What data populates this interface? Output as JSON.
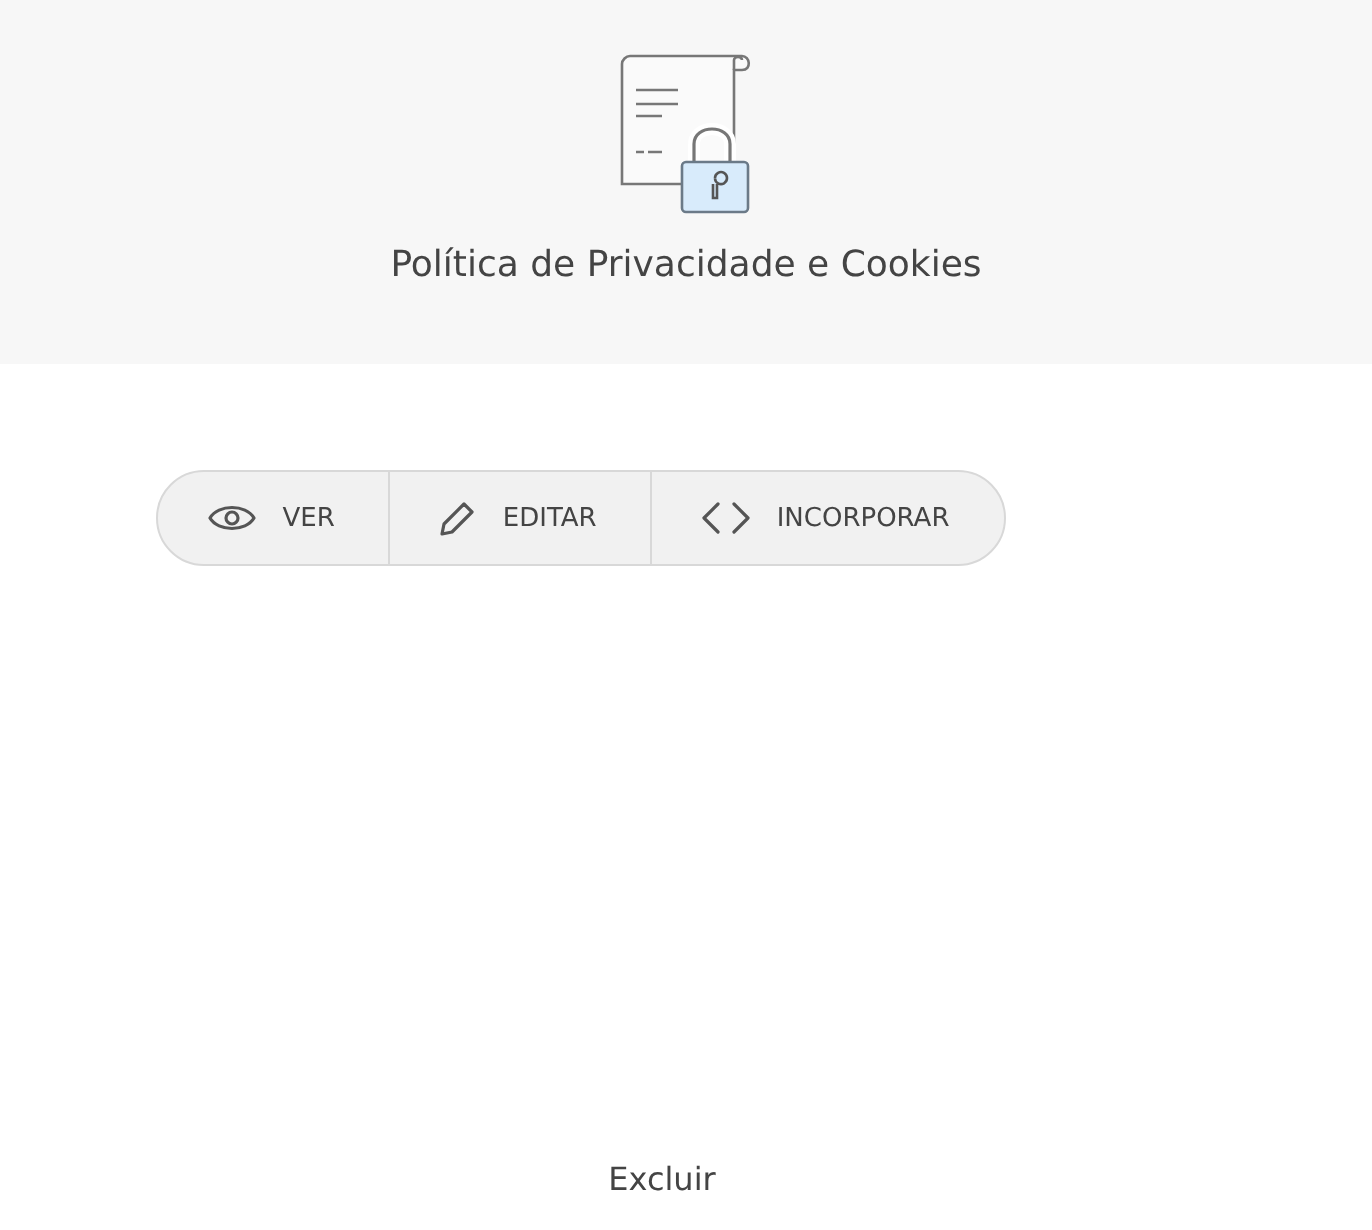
{
  "header": {
    "title": "Política de Privacidade e Cookies"
  },
  "actions": [
    {
      "kind": "view",
      "label": "VER"
    },
    {
      "kind": "edit",
      "label": "EDITAR"
    },
    {
      "kind": "embed",
      "label": "INCORPORAR"
    }
  ],
  "footer": {
    "link": "Excluir"
  }
}
